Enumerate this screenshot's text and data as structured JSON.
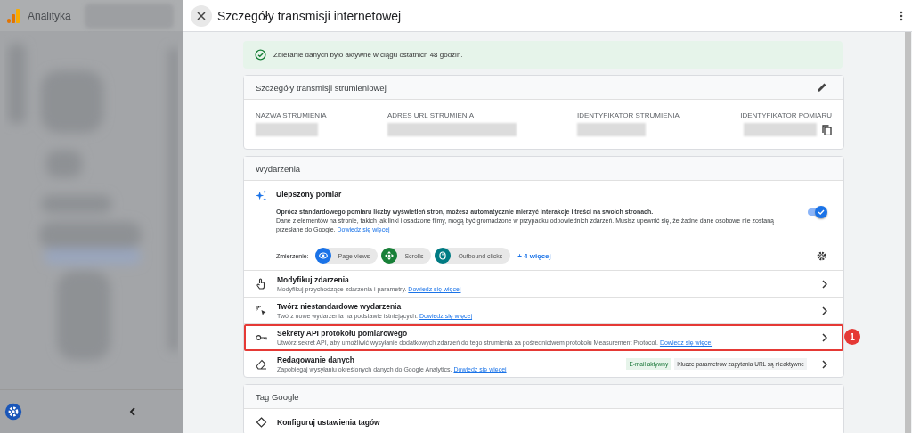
{
  "app": {
    "name": "Analityka"
  },
  "drawer": {
    "title": "Szczegóły transmisji internetowej",
    "banner": "Zbieranie danych było aktywne w ciągu ostatnich 48 godzin.",
    "stream_card": {
      "title": "Szczegóły transmisji strumieniowej",
      "fields": [
        {
          "label": "NAZWA STRUMIENIA"
        },
        {
          "label": "ADRES URL STRUMIENIA"
        },
        {
          "label": "IDENTYFIKATOR STRUMIENIA"
        },
        {
          "label": "IDENTYFIKATOR POMIARU"
        }
      ]
    },
    "events_card": {
      "title": "Wydarzenia",
      "enhanced": {
        "title": "Ulepszony pomiar",
        "lead": "Oprócz standardowego pomiaru liczby wyświetleń stron, możesz automatycznie mierzyć interakcje i treści na swoich stronach.",
        "description": "Dane z elementów na stronie, takich jak linki i osadzone filmy, mogą być gromadzone w przypadku odpowiednich zdarzeń. Musisz upewnić się, że żadne dane osobowe nie zostaną przesłane do Google.",
        "link": "Dowiedz się więcej",
        "on": true,
        "measuring_label": "Zmierzenie:",
        "chips": [
          {
            "label": "Page views",
            "color": "#1a73e8"
          },
          {
            "label": "Scrolls",
            "color": "#188038"
          },
          {
            "label": "Outbound clicks",
            "color": "#007b83"
          }
        ],
        "more": "+ 4 więcej"
      },
      "rows": [
        {
          "title": "Modyfikuj zdarzenia",
          "description": "Modyfikuj przychodzące zdarzenia i parametry.",
          "link": "Dowiedz się więcej",
          "highlighted": false
        },
        {
          "title": "Twórz niestandardowe wydarzenia",
          "description": "Twórz nowe wydarzenia na podstawie istniejących.",
          "link": "Dowiedz się więcej",
          "highlighted": false
        },
        {
          "title": "Sekrety API protokołu pomiarowego",
          "description": "Utwórz sekret API, aby umożliwić wysyłanie dodatkowych zdarzeń do tego strumienia za pośrednictwem protokołu Measurement Protocol.",
          "link": "Dowiedz się więcej",
          "highlighted": true
        },
        {
          "title": "Redagowanie danych",
          "description": "Zapobiegaj wysyłaniu określonych danych do Google Analytics.",
          "link": "Dowiedz się więcej",
          "highlighted": false,
          "badges": [
            {
              "label": "E-mail aktywny",
              "active": true
            },
            {
              "label": "Klucze parametrów zapytania URL są nieaktywne",
              "active": false
            }
          ]
        }
      ]
    },
    "tag_card": {
      "title": "Tag Google",
      "rows": [
        {
          "title": "Konfiguruj ustawienia tagów"
        }
      ]
    }
  },
  "annotation": {
    "number": "1"
  }
}
